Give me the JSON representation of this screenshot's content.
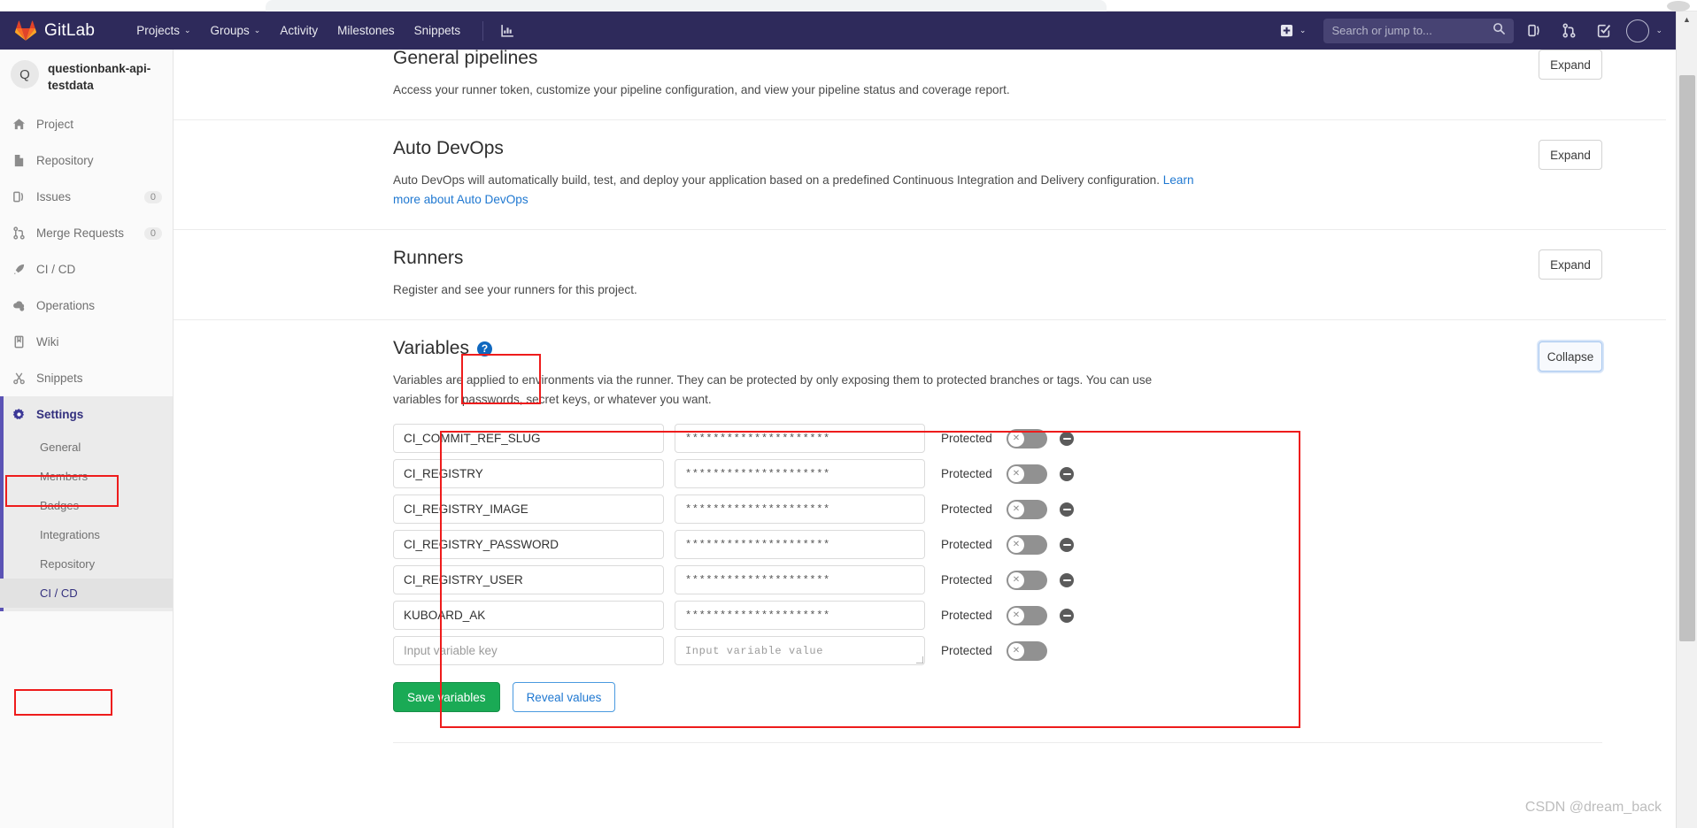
{
  "browser": {
    "tab_region": "browser-tab-strip"
  },
  "navbar": {
    "brand": "GitLab",
    "links": [
      {
        "label": "Projects",
        "caret": "⌄"
      },
      {
        "label": "Groups",
        "caret": "⌄"
      },
      {
        "label": "Activity",
        "caret": ""
      },
      {
        "label": "Milestones",
        "caret": ""
      },
      {
        "label": "Snippets",
        "caret": ""
      }
    ],
    "pipeline_icon": "pipelines-chart-icon",
    "plus_caret": "⌄",
    "search_placeholder": "Search or jump to...",
    "search_value": "",
    "icons": [
      "issues-icon",
      "merge-requests-icon",
      "todos-icon"
    ],
    "avatar_caret": "⌄"
  },
  "sidebar": {
    "project_initial": "Q",
    "project_name": "questionbank-api-testdata",
    "items": [
      {
        "label": "Project",
        "icon": "home-icon",
        "badge": ""
      },
      {
        "label": "Repository",
        "icon": "document-icon",
        "badge": ""
      },
      {
        "label": "Issues",
        "icon": "issues-icon",
        "badge": "0"
      },
      {
        "label": "Merge Requests",
        "icon": "merge-requests-icon",
        "badge": "0"
      },
      {
        "label": "CI / CD",
        "icon": "rocket-icon",
        "badge": ""
      },
      {
        "label": "Operations",
        "icon": "cloud-gear-icon",
        "badge": ""
      },
      {
        "label": "Wiki",
        "icon": "book-icon",
        "badge": ""
      },
      {
        "label": "Snippets",
        "icon": "scissors-icon",
        "badge": ""
      },
      {
        "label": "Settings",
        "icon": "gear-icon",
        "badge": ""
      }
    ],
    "settings_submenu": [
      {
        "label": "General"
      },
      {
        "label": "Members"
      },
      {
        "label": "Badges"
      },
      {
        "label": "Integrations"
      },
      {
        "label": "Repository"
      },
      {
        "label": "CI / CD"
      }
    ]
  },
  "main": {
    "sections": [
      {
        "title": "General pipelines",
        "description": "Access your runner token, customize your pipeline configuration, and view your pipeline status and coverage report.",
        "button": "Expand"
      },
      {
        "title": "Auto DevOps",
        "description": "Auto DevOps will automatically build, test, and deploy your application based on a predefined Continuous Integration and Delivery configuration. ",
        "link": "Learn more about Auto DevOps",
        "button": "Expand"
      },
      {
        "title": "Runners",
        "description": "Register and see your runners for this project.",
        "button": "Expand"
      }
    ],
    "variables": {
      "title": "Variables",
      "help_icon": "?",
      "description": "Variables are applied to environments via the runner. They can be protected by only exposing them to protected branches or tags. You can use variables for passwords, secret keys, or whatever you want.",
      "button": "Collapse",
      "protected_label": "Protected",
      "toggle_off_glyph": "✕",
      "key_placeholder": "Input variable key",
      "value_placeholder": "Input variable value",
      "masked_value": "*********************",
      "rows": [
        {
          "key": "CI_COMMIT_REF_SLUG",
          "value": "*********************",
          "protected": false
        },
        {
          "key": "CI_REGISTRY",
          "value": "*********************",
          "protected": false
        },
        {
          "key": "CI_REGISTRY_IMAGE",
          "value": "*********************",
          "protected": false
        },
        {
          "key": "CI_REGISTRY_PASSWORD",
          "value": "*********************",
          "protected": false
        },
        {
          "key": "CI_REGISTRY_USER",
          "value": "*********************",
          "protected": false
        },
        {
          "key": "KUBOARD_AK",
          "value": "*********************",
          "protected": false
        }
      ],
      "save_button": "Save variables",
      "reveal_button": "Reveal values"
    }
  },
  "watermark": "CSDN @dream_back"
}
